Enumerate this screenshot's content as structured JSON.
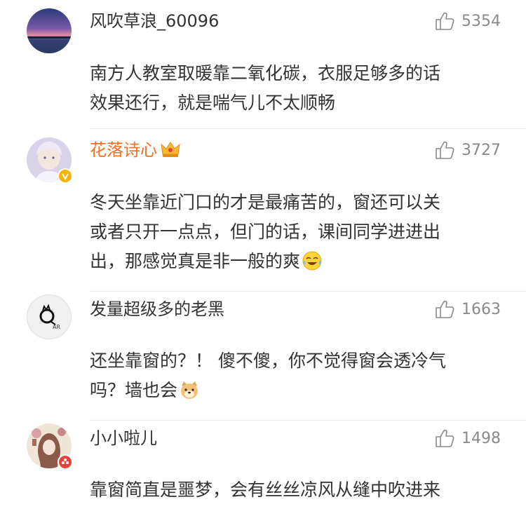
{
  "comments": [
    {
      "username": "风吹草浪_60096",
      "likes": "5354",
      "text_lines": [
        "南方人教室取暖靠二氧化碳，衣服足够多的话",
        "效果还行，就是喘气儿不太顺畅"
      ],
      "avatar_icon": "sunset-lake-avatar"
    },
    {
      "username": "花落诗心",
      "likes": "3727",
      "text_lines": [
        "冬天坐靠近门口的才是最痛苦的，窗还可以关",
        "或者只开一点点，但门的话，课间同学进进出",
        "出，那感觉真是非一般的爽"
      ],
      "avatar_icon": "anime-boy-avatar",
      "badge_icon": "verified-v-badge",
      "vip_icon": "crown-icon",
      "emoji": "laugh-cry-emoji"
    },
    {
      "username": "发量超级多的老黑",
      "likes": "1663",
      "text_lines": [
        "还坐靠窗的？！ 傻不傻，你不觉得窗会透冷气",
        "吗？墙也会"
      ],
      "avatar_icon": "sketch-logo-avatar",
      "emoji": "doge-emoji"
    },
    {
      "username": "小小啦儿",
      "likes": "1498",
      "text_lines": [
        "靠窗简直是噩梦，会有丝丝凉风从缝中吹进来"
      ],
      "avatar_icon": "girl-portrait-avatar",
      "badge_icon": "flower-badge"
    }
  ],
  "colors": {
    "vip_name": "#f86e21",
    "like_gray": "#8a8a8a",
    "text": "#333333",
    "divider": "#e6e6e6",
    "verified": "#f6b400"
  }
}
